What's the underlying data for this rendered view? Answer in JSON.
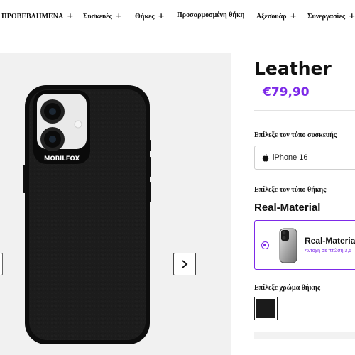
{
  "nav": {
    "items": [
      {
        "label": "ΠΡΟΒΕΒΛΗΜΕΝΑ",
        "has_plus": true
      },
      {
        "label": "Συσκευές",
        "has_plus": true
      },
      {
        "label": "Θήκες",
        "has_plus": true
      },
      {
        "label": "Προσαρμοσμένη θήκη",
        "has_plus": false
      },
      {
        "label": "Αξεσουάρ",
        "has_plus": true
      },
      {
        "label": "Συνεργασίες",
        "has_plus": true
      }
    ],
    "plus_symbol": "+"
  },
  "product": {
    "title": "Leather",
    "price": "€79,90",
    "brand_on_case": "MOBILFOX",
    "case_color": "#1b1b1b"
  },
  "device": {
    "label": "Επίλεξε τον τύπο συσκευής",
    "selected": "iPhone 16",
    "icon": "apple-icon"
  },
  "case_type": {
    "label": "Επίλεξε τον τύπο θήκης",
    "selected": "Real-Material",
    "option_name": "Real-Material",
    "option_sub": "Αντοχή σε πτώση 3,5"
  },
  "color": {
    "label": "Επίλεξε χρώμα θήκης",
    "selected_hex": "#1b1b1b"
  },
  "accent": "#7d2ae8",
  "gallery": {
    "next_icon": "chevron-right-icon",
    "prev_icon": "chevron-left-icon"
  }
}
